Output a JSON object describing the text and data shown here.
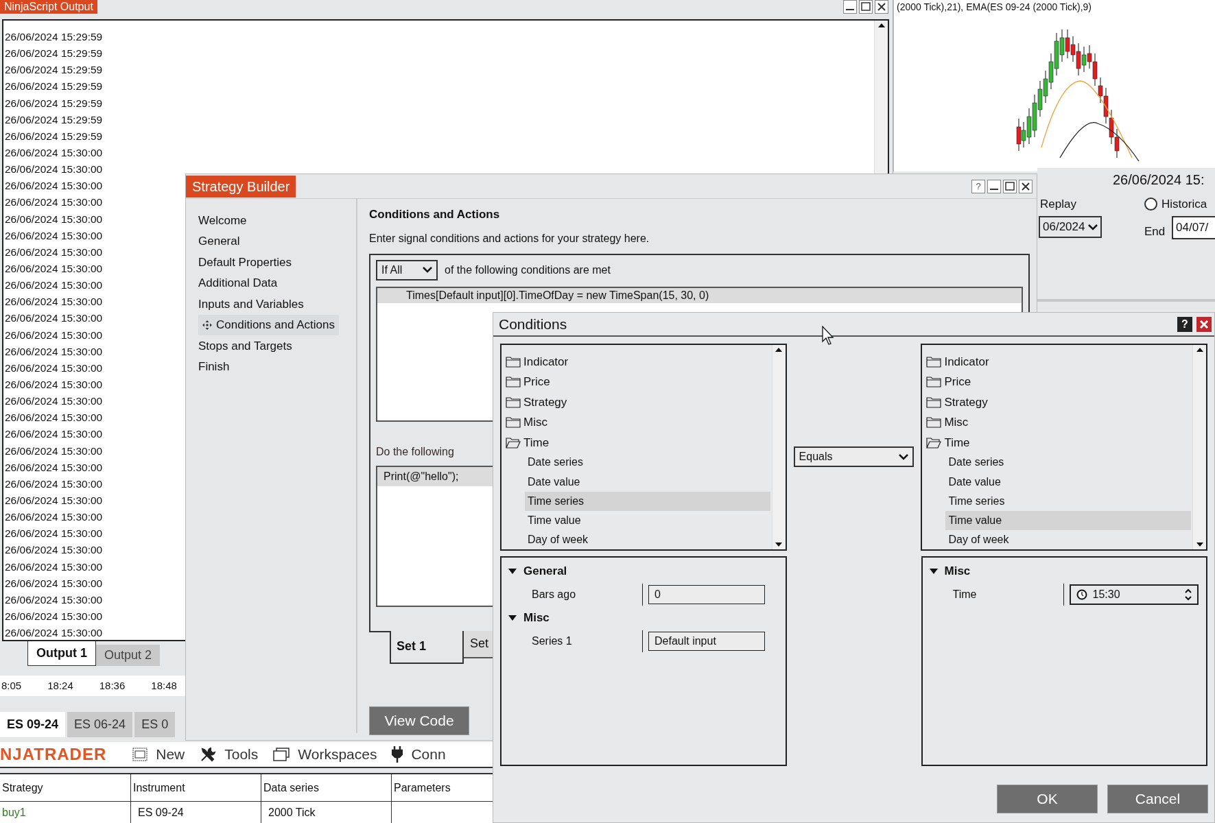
{
  "output_window": {
    "title": "NinjaScript Output",
    "lines": [
      "26/06/2024 15:29:59",
      "26/06/2024 15:29:59",
      "26/06/2024 15:29:59",
      "26/06/2024 15:29:59",
      "26/06/2024 15:29:59",
      "26/06/2024 15:29:59",
      "26/06/2024 15:29:59",
      "26/06/2024 15:30:00",
      "26/06/2024 15:30:00",
      "26/06/2024 15:30:00",
      "26/06/2024 15:30:00",
      "26/06/2024 15:30:00",
      "26/06/2024 15:30:00",
      "26/06/2024 15:30:00",
      "26/06/2024 15:30:00",
      "26/06/2024 15:30:00",
      "26/06/2024 15:30:00",
      "26/06/2024 15:30:00",
      "26/06/2024 15:30:00",
      "26/06/2024 15:30:00",
      "26/06/2024 15:30:00",
      "26/06/2024 15:30:00",
      "26/06/2024 15:30:00",
      "26/06/2024 15:30:00",
      "26/06/2024 15:30:00",
      "26/06/2024 15:30:00",
      "26/06/2024 15:30:00",
      "26/06/2024 15:30:00",
      "26/06/2024 15:30:00",
      "26/06/2024 15:30:00",
      "26/06/2024 15:30:00",
      "26/06/2024 15:30:00",
      "26/06/2024 15:30:00",
      "26/06/2024 15:30:00",
      "26/06/2024 15:30:00",
      "26/06/2024 15:30:00",
      "26/06/2024 15:30:00"
    ],
    "tabs": [
      {
        "label": "Output 1",
        "selected": true
      },
      {
        "label": "Output 2",
        "selected": false
      }
    ],
    "time_axis": [
      "8:05",
      "18:24",
      "18:36",
      "18:48"
    ]
  },
  "chart": {
    "legend": "(2000 Tick),21), EMA(ES 09-24 (2000 Tick),9)"
  },
  "instrument_tabs": [
    {
      "label": "ES 09-24",
      "selected": true
    },
    {
      "label": "ES 06-24",
      "selected": false
    },
    {
      "label": "ES 0",
      "selected": false
    }
  ],
  "control_center": {
    "logo": "NJATRADER",
    "menu": [
      {
        "kind": "new",
        "label": "New"
      },
      {
        "kind": "tools",
        "label": "Tools"
      },
      {
        "kind": "workspaces",
        "label": "Workspaces"
      },
      {
        "kind": "connections",
        "label": "Conn"
      }
    ],
    "table": {
      "columns": [
        "Strategy",
        "Instrument",
        "Data series",
        "Parameters"
      ],
      "rows": [
        {
          "strategy": "buy1",
          "instrument": "ES 09-24",
          "data_series": "2000 Tick"
        }
      ]
    }
  },
  "background_window": {
    "datetime": "26/06/2024 15:",
    "replay": "Replay",
    "historical": {
      "label": "Historica",
      "selected": false
    },
    "start": "06/2024",
    "end_label": "End",
    "end": "04/07/"
  },
  "strategy_builder": {
    "title": "Strategy Builder",
    "help_label": "?",
    "nav": [
      {
        "label": "Welcome",
        "selected": false
      },
      {
        "label": "General",
        "selected": false
      },
      {
        "label": "Default Properties",
        "selected": false
      },
      {
        "label": "Additional Data",
        "selected": false
      },
      {
        "label": "Inputs and Variables",
        "selected": false
      },
      {
        "label": "Conditions and Actions",
        "selected": true
      },
      {
        "label": "Stops and Targets",
        "selected": false
      },
      {
        "label": "Finish",
        "selected": false
      }
    ],
    "heading": "Conditions and Actions",
    "description": "Enter signal conditions and actions for your strategy here.",
    "match_mode": "If All",
    "match_text": "of the following conditions are met",
    "conditions": [
      {
        "text": "Times[Default input][0].TimeOfDay = new TimeSpan(15, 30, 0)",
        "selected": true
      }
    ],
    "actions_label": "Do the following",
    "actions": [
      {
        "text": "Print(@\"hello\");",
        "selected": true
      }
    ],
    "set_tabs": [
      {
        "label": "Set 1",
        "selected": true
      },
      {
        "label": "Set",
        "selected": false
      }
    ],
    "view_code": "View Code"
  },
  "conditions_dialog": {
    "title": "Conditions",
    "help_label": "?",
    "left_tree": [
      {
        "label": "Indicator",
        "expanded": false
      },
      {
        "label": "Price",
        "expanded": false
      },
      {
        "label": "Strategy",
        "expanded": false
      },
      {
        "label": "Misc",
        "expanded": false
      },
      {
        "label": "Time",
        "expanded": true,
        "children": [
          {
            "label": "Date series",
            "selected": false
          },
          {
            "label": "Date value",
            "selected": false
          },
          {
            "label": "Time series",
            "selected": true
          },
          {
            "label": "Time value",
            "selected": false
          },
          {
            "label": "Day of week",
            "selected": false
          }
        ]
      }
    ],
    "operator": "Equals",
    "right_tree": [
      {
        "label": "Indicator",
        "expanded": false
      },
      {
        "label": "Price",
        "expanded": false
      },
      {
        "label": "Strategy",
        "expanded": false
      },
      {
        "label": "Misc",
        "expanded": false
      },
      {
        "label": "Time",
        "expanded": true,
        "children": [
          {
            "label": "Date series",
            "selected": false
          },
          {
            "label": "Date value",
            "selected": false
          },
          {
            "label": "Time series",
            "selected": false
          },
          {
            "label": "Time value",
            "selected": true
          },
          {
            "label": "Day of week",
            "selected": false
          }
        ]
      }
    ],
    "left_props": [
      {
        "category": "General",
        "expanded": true,
        "rows": [
          {
            "kind": "text",
            "label": "Bars ago",
            "value": "0"
          }
        ]
      },
      {
        "category": "Misc",
        "expanded": true,
        "rows": [
          {
            "kind": "text",
            "label": "Series 1",
            "value": "Default input"
          }
        ]
      }
    ],
    "right_props": [
      {
        "category": "Misc",
        "expanded": true,
        "rows": [
          {
            "kind": "time",
            "label": "Time",
            "value": "15:30"
          }
        ]
      }
    ],
    "buttons": [
      "OK",
      "Cancel"
    ]
  }
}
